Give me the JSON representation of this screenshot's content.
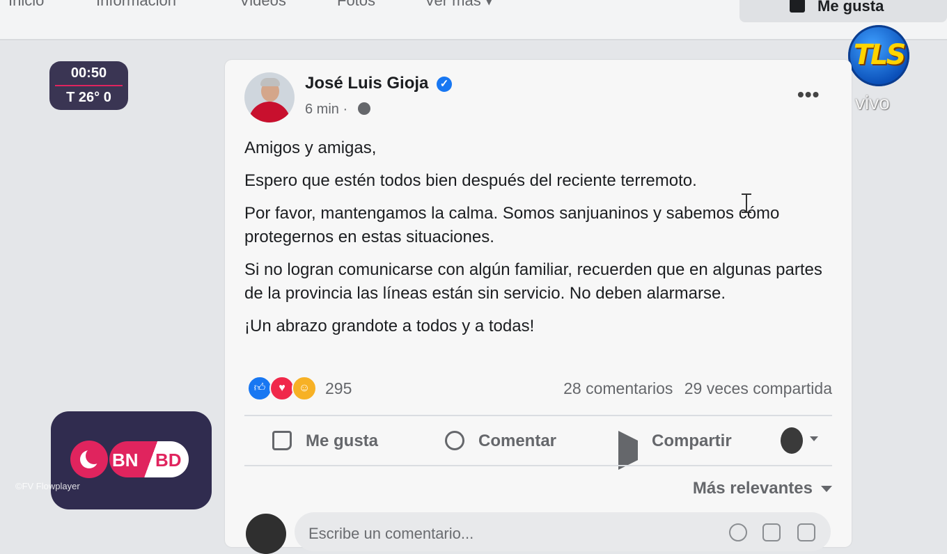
{
  "topnav": {
    "tabs": [
      "Inicio",
      "Información",
      "Videos",
      "Fotos",
      "Ver más ▾"
    ],
    "like_button": "Me gusta"
  },
  "overlay": {
    "clock_time": "00:50",
    "temperature": "T 26° 0",
    "channel_logo": "TLS",
    "live_label": "vivo",
    "bnbd_left": "BN",
    "bnbd_right": "BD",
    "watermark": "©FV Flowplayer"
  },
  "post": {
    "author": "José Luis Gioja",
    "verified_icon": "✓",
    "time": "6 min ·",
    "more_icon": "•••",
    "paragraphs": [
      "Amigos y amigas,",
      "Espero que estén todos bien después del reciente terremoto.",
      "Por favor, mantengamos la calma. Somos sanjuaninos y sabemos cómo protegernos en estas situaciones.",
      "Si no logran comunicarse con algún familiar, recuerden que en algunas partes de la provincia las líneas están sin servicio. No deben alarmarse.",
      "¡Un abrazo grandote a todos y a todas!"
    ],
    "reaction_count": "295",
    "comments": "28 comentarios",
    "shares": "29 veces compartida",
    "actions": {
      "like": "Me gusta",
      "comment": "Comentar",
      "share": "Compartir"
    },
    "sort_label": "Más relevantes",
    "comment_placeholder": "Escribe un comentario..."
  },
  "colors": {
    "brand_blue": "#1877f2",
    "overlay_dark": "#302c4f",
    "accent_pink": "#e0245e"
  }
}
